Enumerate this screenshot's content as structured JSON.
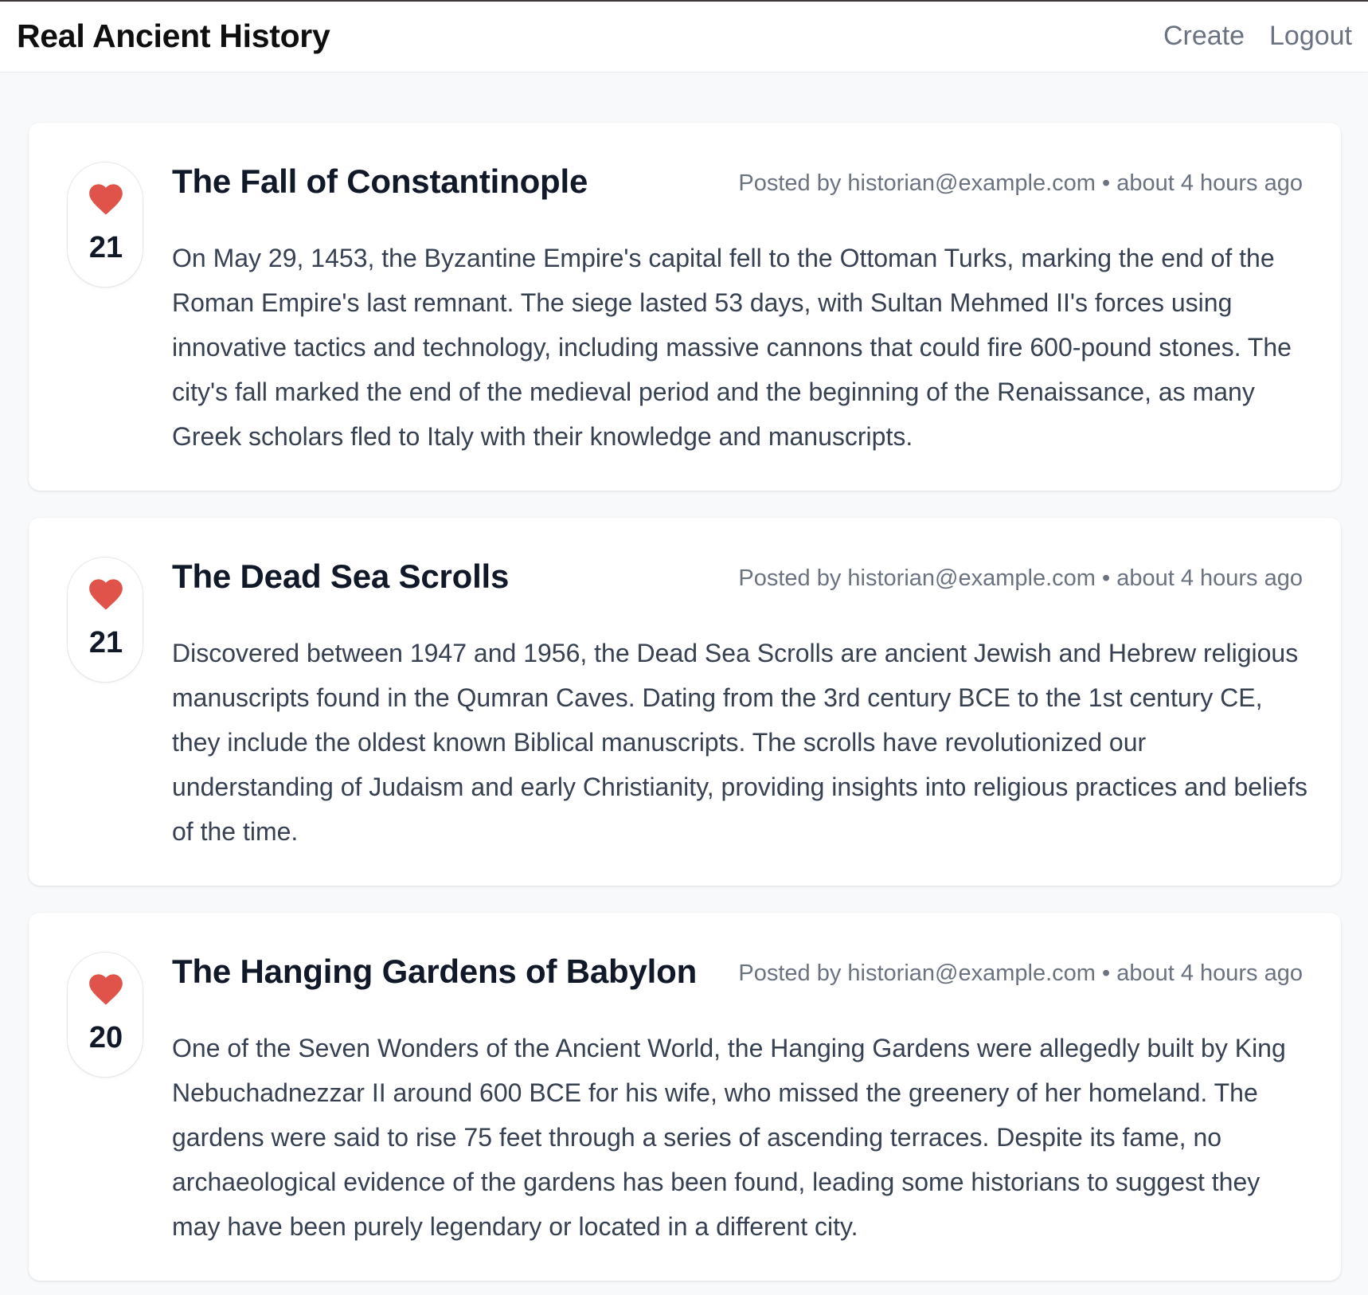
{
  "header": {
    "title": "Real Ancient History",
    "nav": {
      "create": "Create",
      "logout": "Logout"
    }
  },
  "theme": {
    "heart_color": "#e0534b"
  },
  "posts": [
    {
      "likes": "21",
      "title": "The Fall of Constantinople",
      "meta": "Posted by historian@example.com • about 4 hours ago",
      "body": "On May 29, 1453, the Byzantine Empire's capital fell to the Ottoman Turks, marking the end of the Roman Empire's last remnant. The siege lasted 53 days, with Sultan Mehmed II's forces using innovative tactics and technology, including massive cannons that could fire 600-pound stones. The city's fall marked the end of the medieval period and the beginning of the Renaissance, as many Greek scholars fled to Italy with their knowledge and manuscripts."
    },
    {
      "likes": "21",
      "title": "The Dead Sea Scrolls",
      "meta": "Posted by historian@example.com • about 4 hours ago",
      "body": "Discovered between 1947 and 1956, the Dead Sea Scrolls are ancient Jewish and Hebrew religious manuscripts found in the Qumran Caves. Dating from the 3rd century BCE to the 1st century CE, they include the oldest known Biblical manuscripts. The scrolls have revolutionized our understanding of Judaism and early Christianity, providing insights into religious practices and beliefs of the time."
    },
    {
      "likes": "20",
      "title": "The Hanging Gardens of Babylon",
      "meta": "Posted by historian@example.com • about 4 hours ago",
      "body": "One of the Seven Wonders of the Ancient World, the Hanging Gardens were allegedly built by King Nebuchadnezzar II around 600 BCE for his wife, who missed the greenery of her homeland. The gardens were said to rise 75 feet through a series of ascending terraces. Despite its fame, no archaeological evidence of the gardens has been found, leading some historians to suggest they may have been purely legendary or located in a different city."
    }
  ]
}
